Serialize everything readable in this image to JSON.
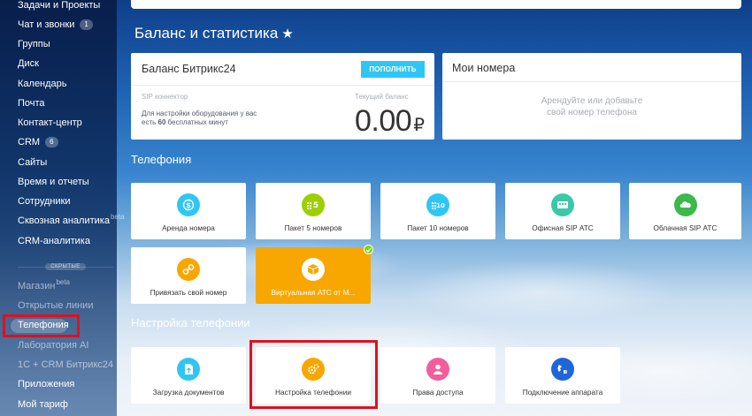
{
  "sidebar": {
    "items": [
      {
        "label": "Задачи и Проекты"
      },
      {
        "label": "Чат и звонки",
        "badge": "1"
      },
      {
        "label": "Группы"
      },
      {
        "label": "Диск"
      },
      {
        "label": "Календарь"
      },
      {
        "label": "Почта"
      },
      {
        "label": "Контакт-центр"
      },
      {
        "label": "CRM",
        "badge": "6"
      },
      {
        "label": "Сайты"
      },
      {
        "label": "Время и отчеты"
      },
      {
        "label": "Сотрудники"
      },
      {
        "label": "Сквозная аналитика",
        "sup": "beta"
      },
      {
        "label": "CRM-аналитика"
      }
    ],
    "hidden_label": "СКРЫТЫЕ",
    "hidden_items": [
      {
        "label": "Магазин",
        "sup": "beta"
      },
      {
        "label": "Открытые линии"
      },
      {
        "label": "Телефония"
      },
      {
        "label": "Лаборатория AI"
      },
      {
        "label": "1С + CRM Битрикс24"
      },
      {
        "label": "Приложения"
      },
      {
        "label": "Мой тариф"
      }
    ]
  },
  "page": {
    "title": "Баланс и статистика",
    "star": "★"
  },
  "balance": {
    "title": "Баланс Битрикс24",
    "topup_label": "ПОПОЛНИТЬ",
    "sip_label": "SIP коннектор",
    "sip_desc_1": "Для настройки оборудования у вас",
    "sip_desc_2_prefix": "есть ",
    "sip_desc_2_bold": "60",
    "sip_desc_2_suffix": " бесплатных минут",
    "current_label": "Текущий баланс",
    "amount": "0.00",
    "currency": "₽"
  },
  "numbers": {
    "title": "Мои номера",
    "empty_line1": "Арендуйте или добавьте",
    "empty_line2": "свой номер телефона"
  },
  "telephony": {
    "section_title": "Телефония",
    "tiles": [
      {
        "label": "Аренда номера",
        "icon": "phone-dollar-icon",
        "color": "#2fc6f6"
      },
      {
        "label": "Пакет 5 номеров",
        "icon": "number-pack-5-icon",
        "color": "#9dcf00"
      },
      {
        "label": "Пакет 10 номеров",
        "icon": "number-pack-10-icon",
        "color": "#2fc6f6"
      },
      {
        "label": "Офисная SIP АТС",
        "icon": "office-pbx-icon",
        "color": "#3bc8a8"
      },
      {
        "label": "Облачная SIP АТС",
        "icon": "cloud-pbx-icon",
        "color": "#3bb94a"
      },
      {
        "label": "Привязать свой номер",
        "icon": "link-number-icon",
        "color": "#f7a700"
      },
      {
        "label": "Виртуальная АТС от М...",
        "icon": "virtual-pbx-icon",
        "color": "#f7a700",
        "selected": true
      }
    ]
  },
  "settings": {
    "section_title": "Настройка телефонии",
    "tiles": [
      {
        "label": "Загрузка документов",
        "icon": "document-upload-icon",
        "color": "#2fc6f6"
      },
      {
        "label": "Настройка телефонии",
        "icon": "telephony-settings-icon",
        "color": "#f7a700"
      },
      {
        "label": "Права доступа",
        "icon": "access-rights-icon",
        "color": "#f35d9b"
      },
      {
        "label": "Подключение аппарата",
        "icon": "device-connect-icon",
        "color": "#2066d8"
      }
    ]
  },
  "colors": {
    "accent": "#2fc6f6",
    "highlight_frame": "#e0101e",
    "selected_tile": "#f7a700"
  }
}
